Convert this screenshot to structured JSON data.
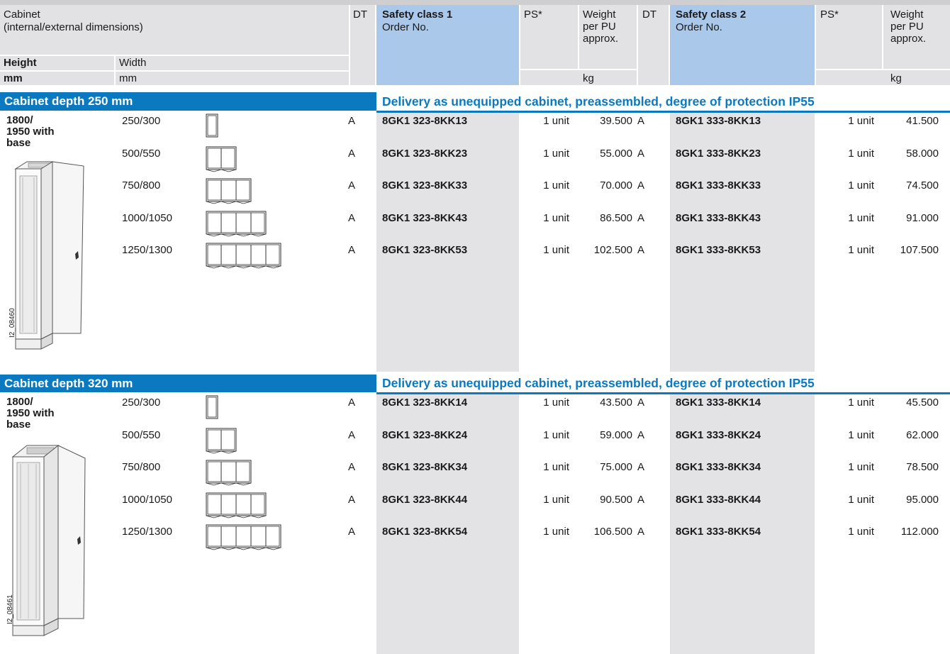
{
  "header": {
    "cabinet_line1": "Cabinet",
    "cabinet_line2": "(internal/external dimensions)",
    "height": "Height",
    "width": "Width",
    "mm_bold": "mm",
    "mm": "mm",
    "dt": "DT",
    "safety_class_1": "Safety class 1",
    "safety_class_2": "Safety class 2",
    "order_no": "Order No.",
    "ps": "PS*",
    "weight_l1": "Weight",
    "weight_l2": "per PU",
    "weight_l3": "approx.",
    "kg": "kg"
  },
  "sections": [
    {
      "title": "Cabinet depth 250 mm",
      "delivery": "Delivery as unequipped cabinet, preassembled, degree of protection IP55",
      "height_l1": "1800/",
      "height_l2": "1950 with",
      "height_l3": "base",
      "image_id": "I2_08460",
      "rows": [
        {
          "width": "250/300",
          "dt1": "A",
          "order1": "8GK1 323-8KK13",
          "ps1": "1 unit",
          "weight1": "39.500",
          "dt2": "A",
          "order2": "8GK1 333-8KK13",
          "ps2": "1 unit",
          "weight2": "41.500"
        },
        {
          "width": "500/550",
          "dt1": "A",
          "order1": "8GK1 323-8KK23",
          "ps1": "1 unit",
          "weight1": "55.000",
          "dt2": "A",
          "order2": "8GK1 333-8KK23",
          "ps2": "1 unit",
          "weight2": "58.000"
        },
        {
          "width": "750/800",
          "dt1": "A",
          "order1": "8GK1 323-8KK33",
          "ps1": "1 unit",
          "weight1": "70.000",
          "dt2": "A",
          "order2": "8GK1 333-8KK33",
          "ps2": "1 unit",
          "weight2": "74.500"
        },
        {
          "width": "1000/1050",
          "dt1": "A",
          "order1": "8GK1 323-8KK43",
          "ps1": "1 unit",
          "weight1": "86.500",
          "dt2": "A",
          "order2": "8GK1 333-8KK43",
          "ps2": "1 unit",
          "weight2": "91.000"
        },
        {
          "width": "1250/1300",
          "dt1": "A",
          "order1": "8GK1 323-8KK53",
          "ps1": "1 unit",
          "weight1": "102.500",
          "dt2": "A",
          "order2": "8GK1 333-8KK53",
          "ps2": "1 unit",
          "weight2": "107.500"
        }
      ]
    },
    {
      "title": "Cabinet depth 320 mm",
      "delivery": "Delivery as unequipped cabinet, preassembled, degree of protection IP55",
      "height_l1": "1800/",
      "height_l2": "1950 with",
      "height_l3": "base",
      "image_id": "I2_08461",
      "rows": [
        {
          "width": "250/300",
          "dt1": "A",
          "order1": "8GK1 323-8KK14",
          "ps1": "1 unit",
          "weight1": "43.500",
          "dt2": "A",
          "order2": "8GK1 333-8KK14",
          "ps2": "1 unit",
          "weight2": "45.500"
        },
        {
          "width": "500/550",
          "dt1": "A",
          "order1": "8GK1 323-8KK24",
          "ps1": "1 unit",
          "weight1": "59.000",
          "dt2": "A",
          "order2": "8GK1 333-8KK24",
          "ps2": "1 unit",
          "weight2": "62.000"
        },
        {
          "width": "750/800",
          "dt1": "A",
          "order1": "8GK1 323-8KK34",
          "ps1": "1 unit",
          "weight1": "75.000",
          "dt2": "A",
          "order2": "8GK1 333-8KK34",
          "ps2": "1 unit",
          "weight2": "78.500"
        },
        {
          "width": "1000/1050",
          "dt1": "A",
          "order1": "8GK1 323-8KK44",
          "ps1": "1 unit",
          "weight1": "90.500",
          "dt2": "A",
          "order2": "8GK1 333-8KK44",
          "ps2": "1 unit",
          "weight2": "95.000"
        },
        {
          "width": "1250/1300",
          "dt1": "A",
          "order1": "8GK1 323-8KK54",
          "ps1": "1 unit",
          "weight1": "106.500",
          "dt2": "A",
          "order2": "8GK1 333-8KK54",
          "ps2": "1 unit",
          "weight2": "112.000"
        }
      ]
    }
  ]
}
